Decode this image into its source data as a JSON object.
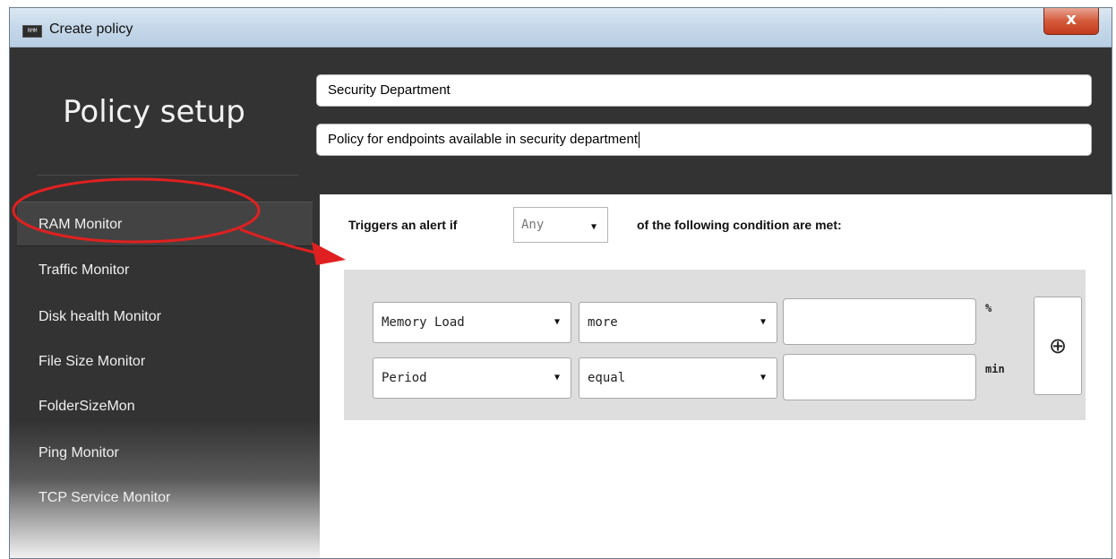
{
  "window": {
    "title": "Create policy",
    "icon_label": "RMM",
    "close_label": "x"
  },
  "header": {
    "title": "Policy setup",
    "name_value": "Security Department",
    "description_value": "Policy for endpoints available in security department"
  },
  "sidebar": {
    "items": [
      {
        "label": "RAM  Monitor",
        "active": true
      },
      {
        "label": "Traffic  Monitor",
        "active": false
      },
      {
        "label": "Disk health Monitor",
        "active": false
      },
      {
        "label": "File Size Monitor",
        "active": false
      },
      {
        "label": "FolderSizeMon",
        "active": false
      },
      {
        "label": "Ping Monitor",
        "active": false
      },
      {
        "label": "TCP Service Monitor",
        "active": false
      }
    ]
  },
  "trigger": {
    "prefix": "Triggers an alert if",
    "match_value": "Any",
    "suffix": "of the following condition are met:"
  },
  "conditions": [
    {
      "field": "Memory Load",
      "operator": "more",
      "value": "",
      "unit": "%"
    },
    {
      "field": "Period",
      "operator": "equal",
      "value": "",
      "unit": "min"
    }
  ],
  "add_condition": {
    "icon": "plus-circle-icon",
    "glyph": "⊕"
  },
  "annotation": {
    "color": "#e02020"
  }
}
